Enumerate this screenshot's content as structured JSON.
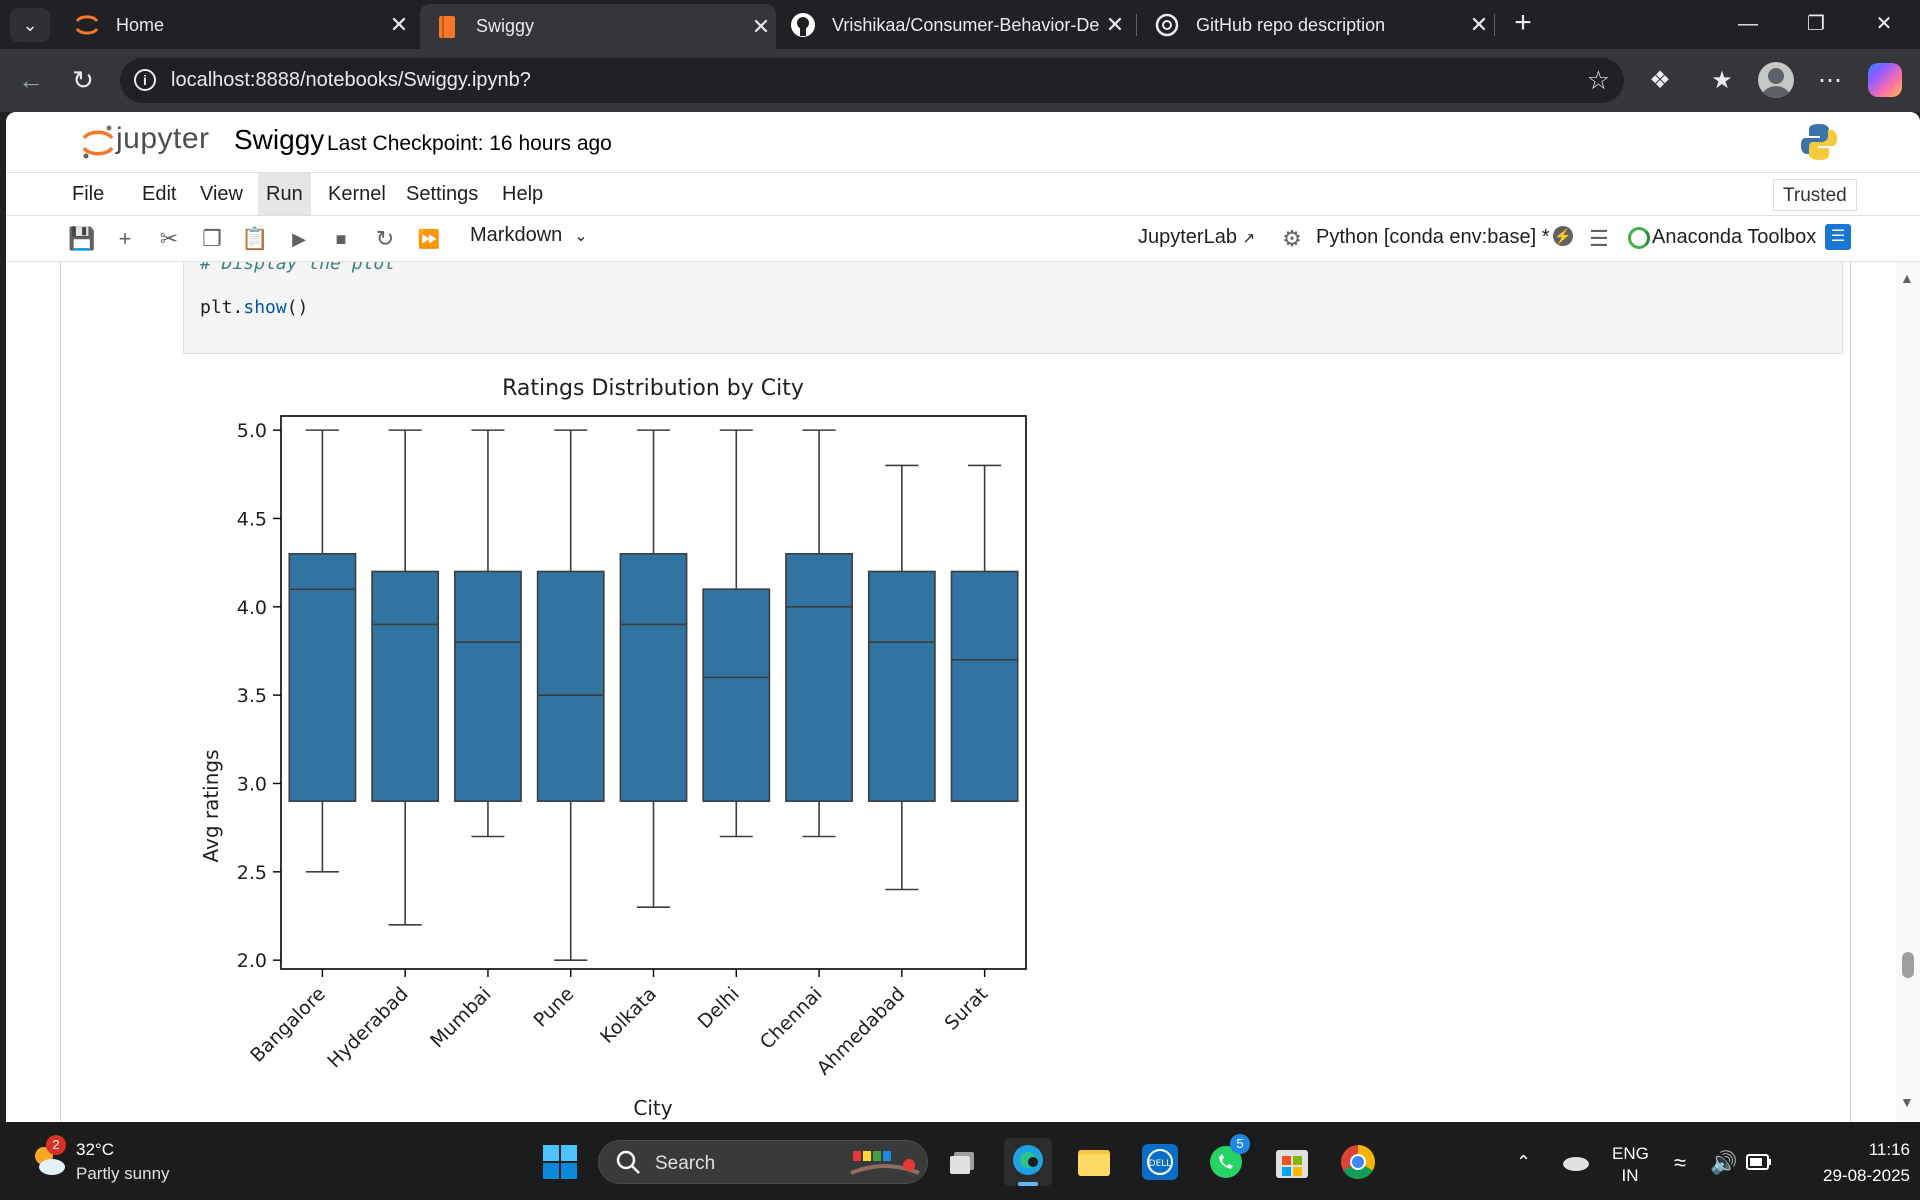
{
  "browser": {
    "tabs": [
      {
        "title": "Home",
        "icon": "jupyter-icon",
        "active": false
      },
      {
        "title": "Swiggy",
        "icon": "notebook-icon",
        "active": true
      },
      {
        "title": "Vrishikaa/Consumer-Behavior-Del",
        "icon": "github-icon",
        "active": false
      },
      {
        "title": "GitHub repo description",
        "icon": "chatgpt-icon",
        "active": false
      }
    ],
    "url": "localhost:8888/notebooks/Swiggy.ipynb?"
  },
  "jupyter": {
    "logo_text": "jupyter",
    "notebook_name": "Swiggy",
    "checkpoint": "Last Checkpoint: 16 hours ago",
    "menu": [
      "File",
      "Edit",
      "View",
      "Run",
      "Kernel",
      "Settings",
      "Help"
    ],
    "highlighted_menu": "Run",
    "trusted": "Trusted",
    "toolbar": {
      "cell_type": "Markdown",
      "jupyterlab_link": "JupyterLab",
      "kernel": "Python [conda env:base] *",
      "anaconda": "Anaconda Toolbox"
    }
  },
  "cell": {
    "comment": "# Display the plot",
    "code_obj": "plt.",
    "code_fn": "show",
    "code_args": "()"
  },
  "chart_data": {
    "type": "box",
    "title": "Ratings Distribution by City",
    "xlabel": "City",
    "ylabel": "Avg ratings",
    "ylim": [
      1.95,
      5.08
    ],
    "yticks": [
      "2.0",
      "2.5",
      "3.0",
      "3.5",
      "4.0",
      "4.5",
      "5.0"
    ],
    "ytick_values": [
      2.0,
      2.5,
      3.0,
      3.5,
      4.0,
      4.5,
      5.0
    ],
    "color": "#3274a1",
    "categories": [
      "Bangalore",
      "Hyderabad",
      "Mumbai",
      "Pune",
      "Kolkata",
      "Delhi",
      "Chennai",
      "Ahmedabad",
      "Surat"
    ],
    "boxes": [
      {
        "whisker_low": 2.5,
        "q1": 2.9,
        "median": 4.1,
        "q3": 4.3,
        "whisker_high": 5.0
      },
      {
        "whisker_low": 2.2,
        "q1": 2.9,
        "median": 3.9,
        "q3": 4.2,
        "whisker_high": 5.0
      },
      {
        "whisker_low": 2.7,
        "q1": 2.9,
        "median": 3.8,
        "q3": 4.2,
        "whisker_high": 5.0
      },
      {
        "whisker_low": 2.0,
        "q1": 2.9,
        "median": 3.5,
        "q3": 4.2,
        "whisker_high": 5.0
      },
      {
        "whisker_low": 2.3,
        "q1": 2.9,
        "median": 3.9,
        "q3": 4.3,
        "whisker_high": 5.0
      },
      {
        "whisker_low": 2.7,
        "q1": 2.9,
        "median": 3.6,
        "q3": 4.1,
        "whisker_high": 5.0
      },
      {
        "whisker_low": 2.7,
        "q1": 2.9,
        "median": 4.0,
        "q3": 4.3,
        "whisker_high": 5.0
      },
      {
        "whisker_low": 2.4,
        "q1": 2.9,
        "median": 3.8,
        "q3": 4.2,
        "whisker_high": 4.8
      },
      {
        "whisker_low": 2.9,
        "q1": 2.9,
        "median": 3.7,
        "q3": 4.2,
        "whisker_high": 4.8
      }
    ]
  },
  "taskbar": {
    "weather_badge": "2",
    "temperature": "32°C",
    "weather": "Partly sunny",
    "search": "Search",
    "whatsapp_badge": "5",
    "lang_top": "ENG",
    "lang_bottom": "IN",
    "time": "11:16",
    "date": "29-08-2025"
  }
}
